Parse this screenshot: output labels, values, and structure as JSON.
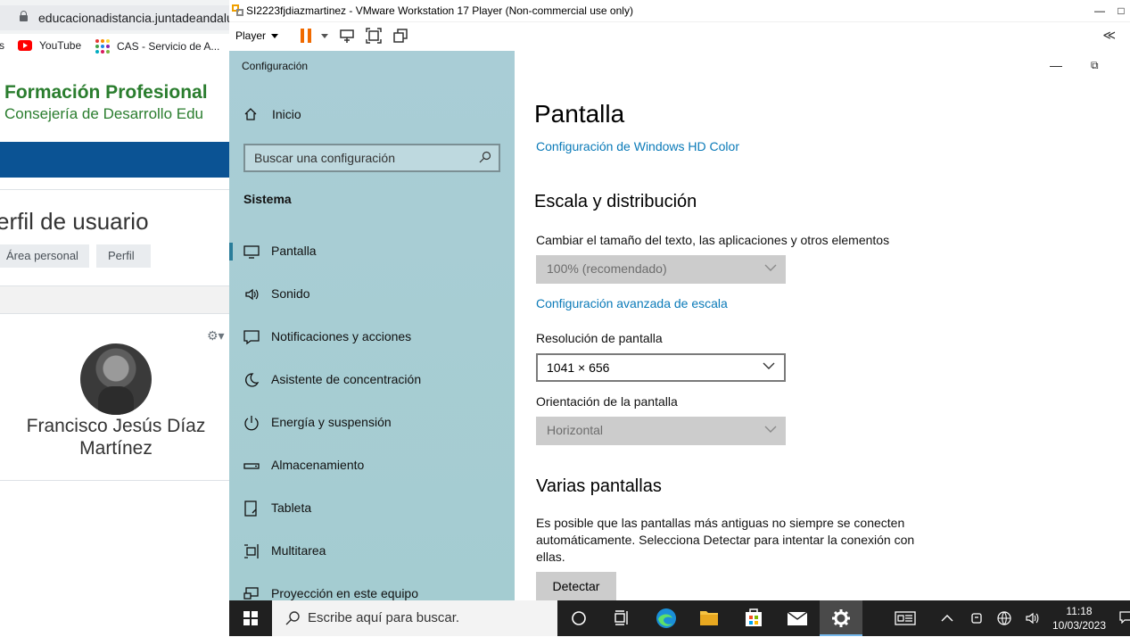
{
  "browser": {
    "url": "educacionadistancia.juntadeandalu",
    "bookmarks": {
      "partial_prefix": "s",
      "youtube": "YouTube",
      "cas": "CAS - Servicio de A..."
    },
    "site_title": "Formación Profesional",
    "site_subtitle": "Consejería de Desarrollo Edu",
    "profile_heading": "erfil de usuario",
    "breadcrumb": [
      "Área personal",
      "Perfil"
    ],
    "user_name": "Francisco Jesús Díaz Martínez"
  },
  "vmware": {
    "window_title": "SI2223fjdiazmartinez - VMware Workstation 17 Player (Non-commercial use only)",
    "player_menu": "Player"
  },
  "settings": {
    "app_title": "Configuración",
    "home": "Inicio",
    "search_placeholder": "Buscar una configuración",
    "section": "Sistema",
    "nav_items": [
      {
        "label": "Pantalla",
        "icon": "monitor-icon",
        "active": true
      },
      {
        "label": "Sonido",
        "icon": "speaker-icon"
      },
      {
        "label": "Notificaciones y acciones",
        "icon": "message-icon"
      },
      {
        "label": "Asistente de concentración",
        "icon": "moon-icon"
      },
      {
        "label": "Energía y suspensión",
        "icon": "power-icon"
      },
      {
        "label": "Almacenamiento",
        "icon": "storage-icon"
      },
      {
        "label": "Tableta",
        "icon": "tablet-icon"
      },
      {
        "label": "Multitarea",
        "icon": "multitask-icon"
      },
      {
        "label": "Proyección en este equipo",
        "icon": "projection-icon"
      }
    ],
    "page_title": "Pantalla",
    "hd_color_link": "Configuración de Windows HD Color",
    "scale_heading": "Escala y distribución",
    "scale_label": "Cambiar el tamaño del texto, las aplicaciones y otros elementos",
    "scale_value": "100% (recomendado)",
    "advanced_scale_link": "Configuración avanzada de escala",
    "resolution_label": "Resolución de pantalla",
    "resolution_value": "1041 × 656",
    "orientation_label": "Orientación de la pantalla",
    "orientation_value": "Horizontal",
    "multi_heading": "Varias pantallas",
    "multi_text": "Es posible que las pantallas más antiguas no siempre se conecten automáticamente. Selecciona Detectar para intentar la conexión con ellas.",
    "detect_button": "Detectar"
  },
  "taskbar": {
    "search_placeholder": "Escribe aquí para buscar.",
    "time": "11:18",
    "date": "10/03/2023"
  }
}
